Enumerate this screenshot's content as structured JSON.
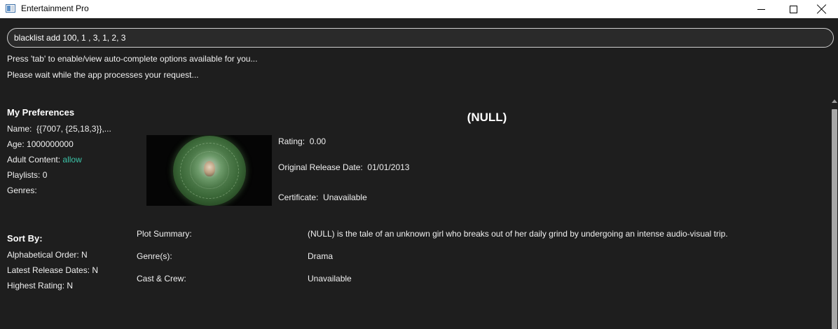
{
  "window": {
    "title": "Entertainment Pro",
    "icon": "app-window-icon"
  },
  "command": {
    "value": "blacklist add 100, 1 , 3, 1, 2, 3"
  },
  "hints": {
    "tab_hint": "Press 'tab' to enable/view auto-complete options available for you...",
    "wait_msg": "Please wait while the app processes your request..."
  },
  "preferences": {
    "heading": "My Preferences",
    "name_label": "Name:",
    "name_value": "{{7007, {25,18,3}},...",
    "age_label": "Age:",
    "age_value": "1000000000",
    "adult_label": "Adult Content:",
    "adult_value": "allow",
    "playlists_label": "Playlists:",
    "playlists_value": "0",
    "genres_label": "Genres:"
  },
  "sort": {
    "heading": "Sort By:",
    "alpha": "Alphabetical Order: N",
    "latest": "Latest Release Dates: N",
    "rating": "Highest Rating: N"
  },
  "movie": {
    "title": "(NULL)",
    "rating_label": "Rating:",
    "rating_value": "0.00",
    "release_label": "Original Release Date:",
    "release_value": "01/01/2013",
    "cert_label": "Certificate:",
    "cert_value": "Unavailable",
    "plot_label": "Plot Summary:",
    "plot_value": "(NULL) is the tale of an unknown girl who breaks out of her daily grind by undergoing an intense audio-visual trip.",
    "genre_label": "Genre(s):",
    "genre_value": "Drama",
    "cast_label": "Cast & Crew:",
    "cast_value": "Unavailable"
  },
  "colors": {
    "background": "#1e1e1e",
    "accent_allow": "#3cc4a8"
  }
}
